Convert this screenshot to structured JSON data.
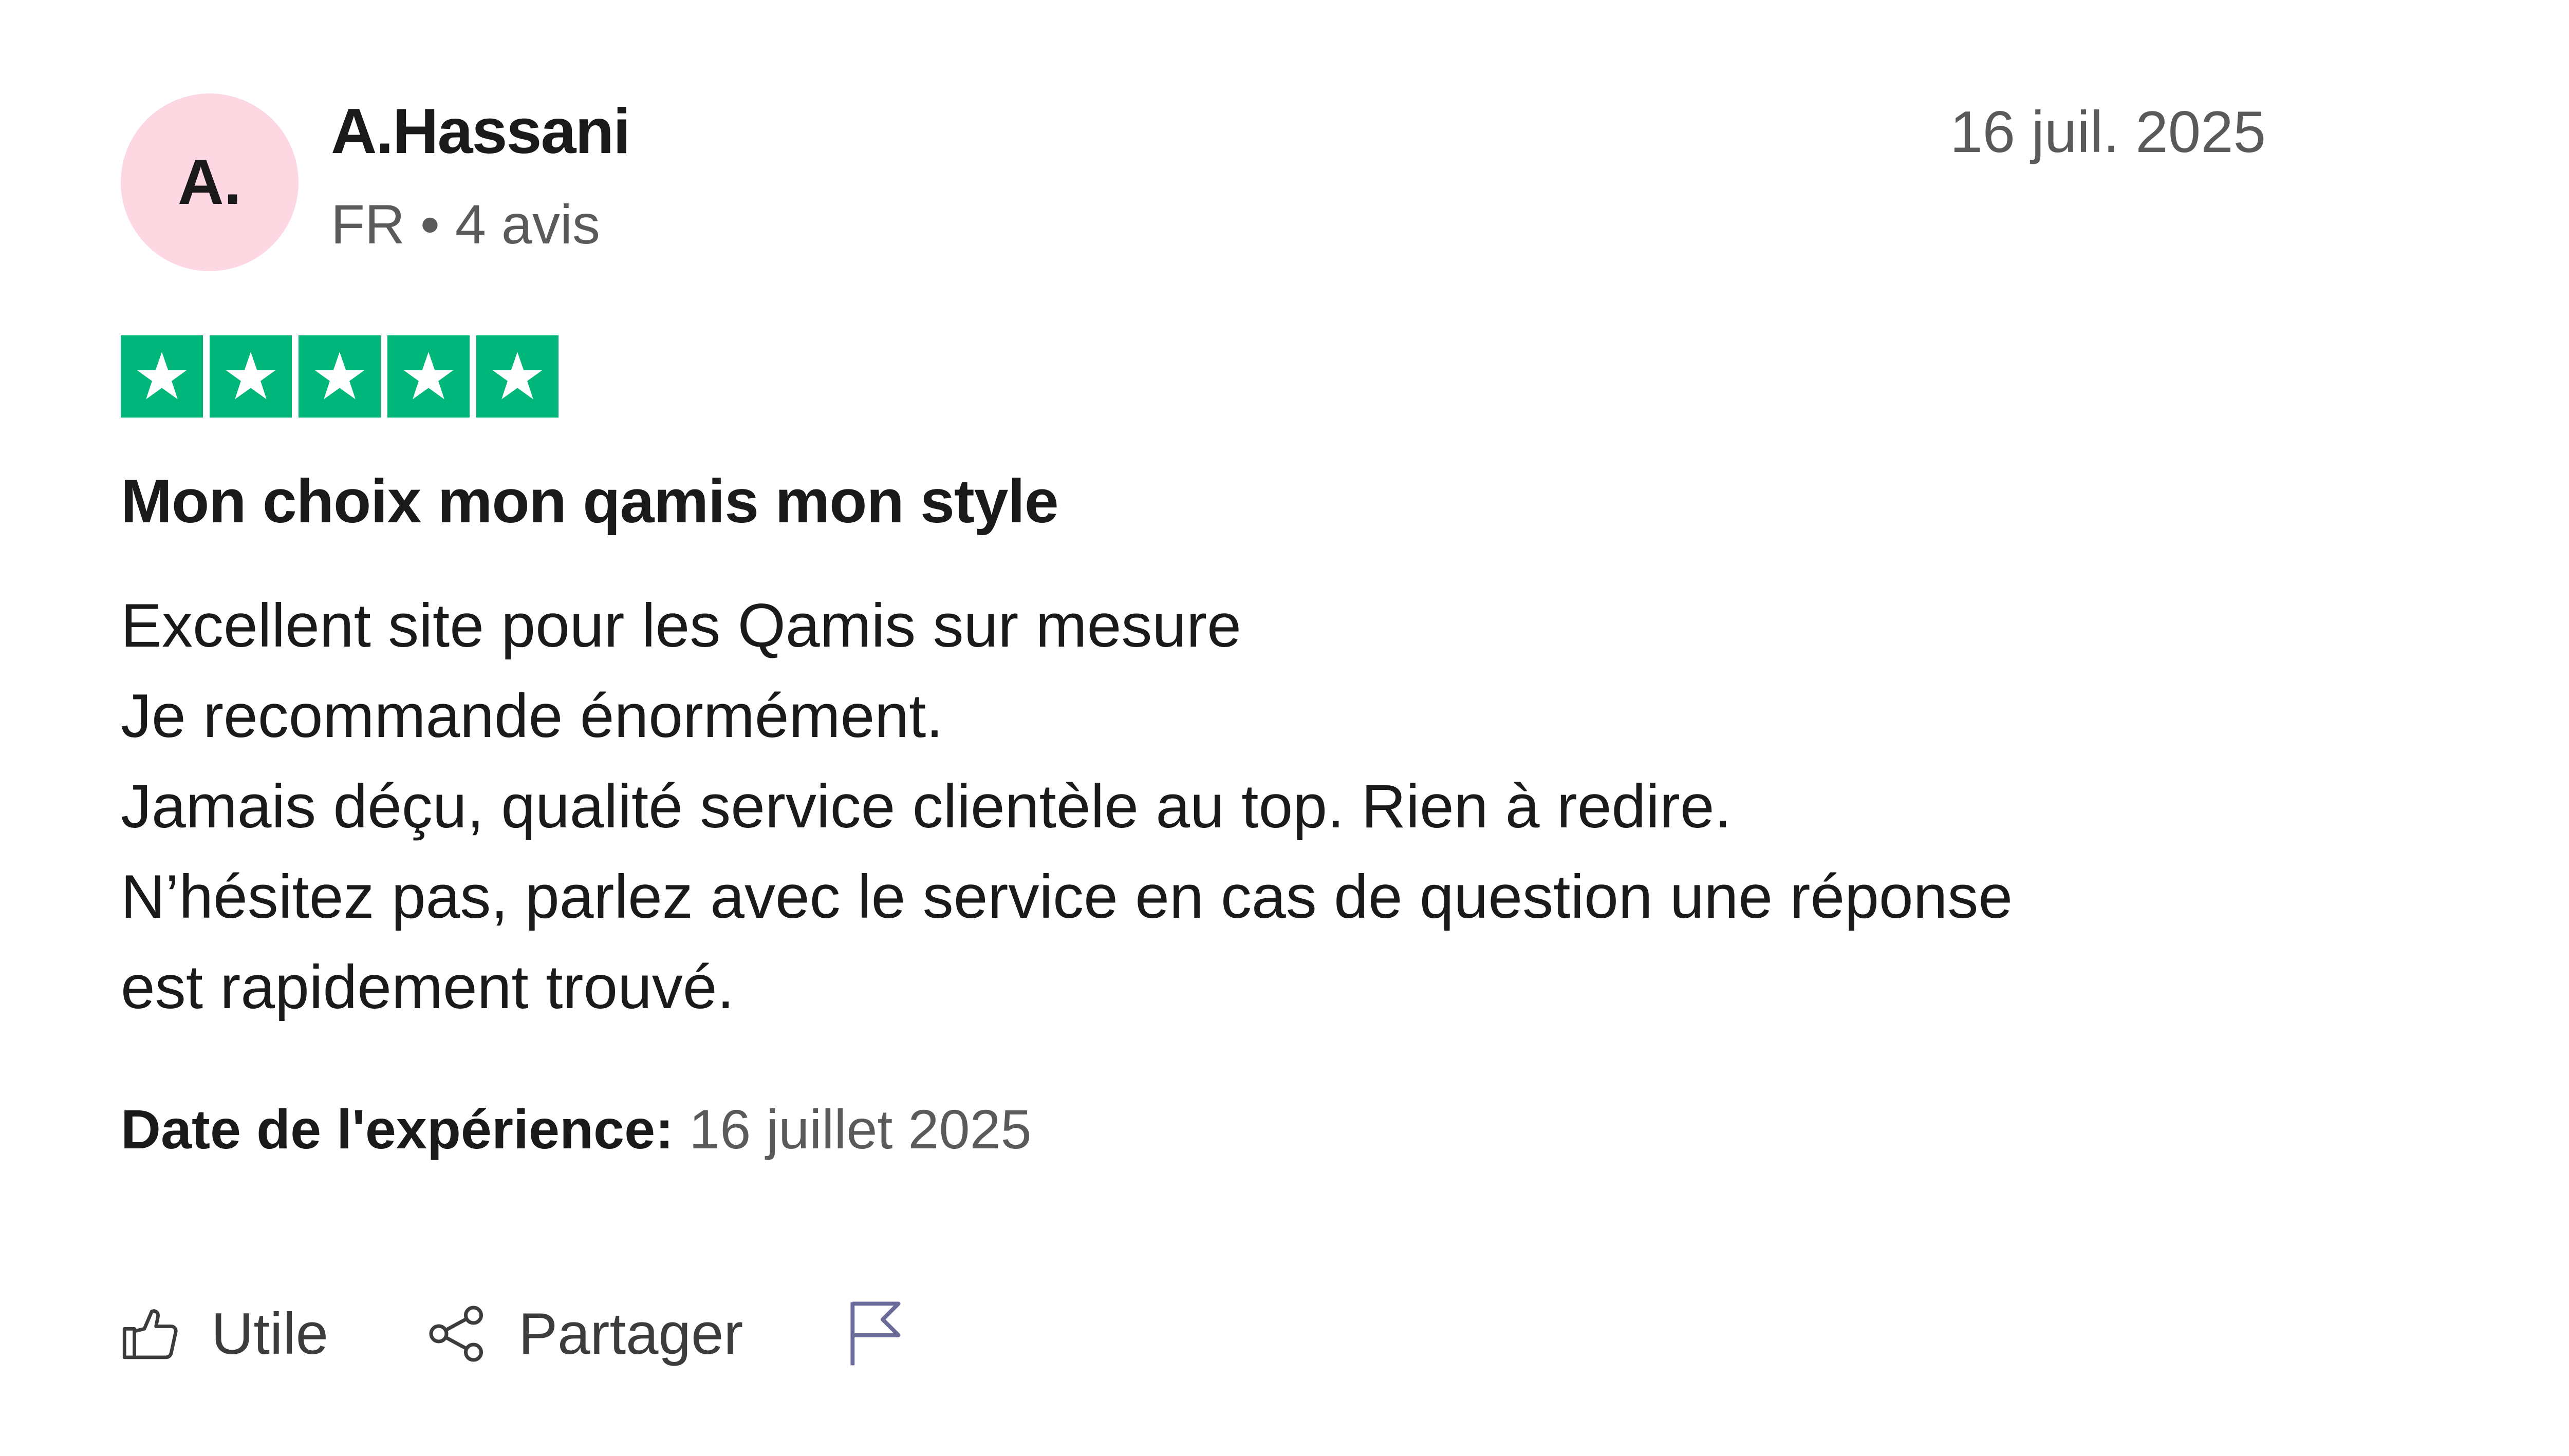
{
  "reviewer": {
    "initials": "A.",
    "name": "A.Hassani",
    "country": "FR",
    "separator": "•",
    "review_count": "4 avis"
  },
  "review": {
    "date": "16 juil. 2025",
    "rating": 5,
    "rating_max": 5,
    "title": "Mon choix mon qamis mon style",
    "body_lines": [
      "Excellent site pour les Qamis sur mesure",
      "Je recommande énormément.",
      "Jamais déçu, qualité service clientèle au top. Rien à redire.",
      "N’hésitez pas, parlez avec le service en cas de question une réponse",
      "est rapidement trouvé."
    ],
    "experience_label": "Date de l'expérience:",
    "experience_date": "16 juillet 2025"
  },
  "actions": {
    "useful_label": "Utile",
    "share_label": "Partager"
  },
  "icons": {
    "useful": "thumbs-up-icon",
    "share": "share-icon",
    "report": "flag-icon",
    "star": "star-icon"
  },
  "colors": {
    "star_green": "#00b67a",
    "avatar_pink": "#fdd8e3",
    "flag_purple": "#6b6b9a"
  }
}
